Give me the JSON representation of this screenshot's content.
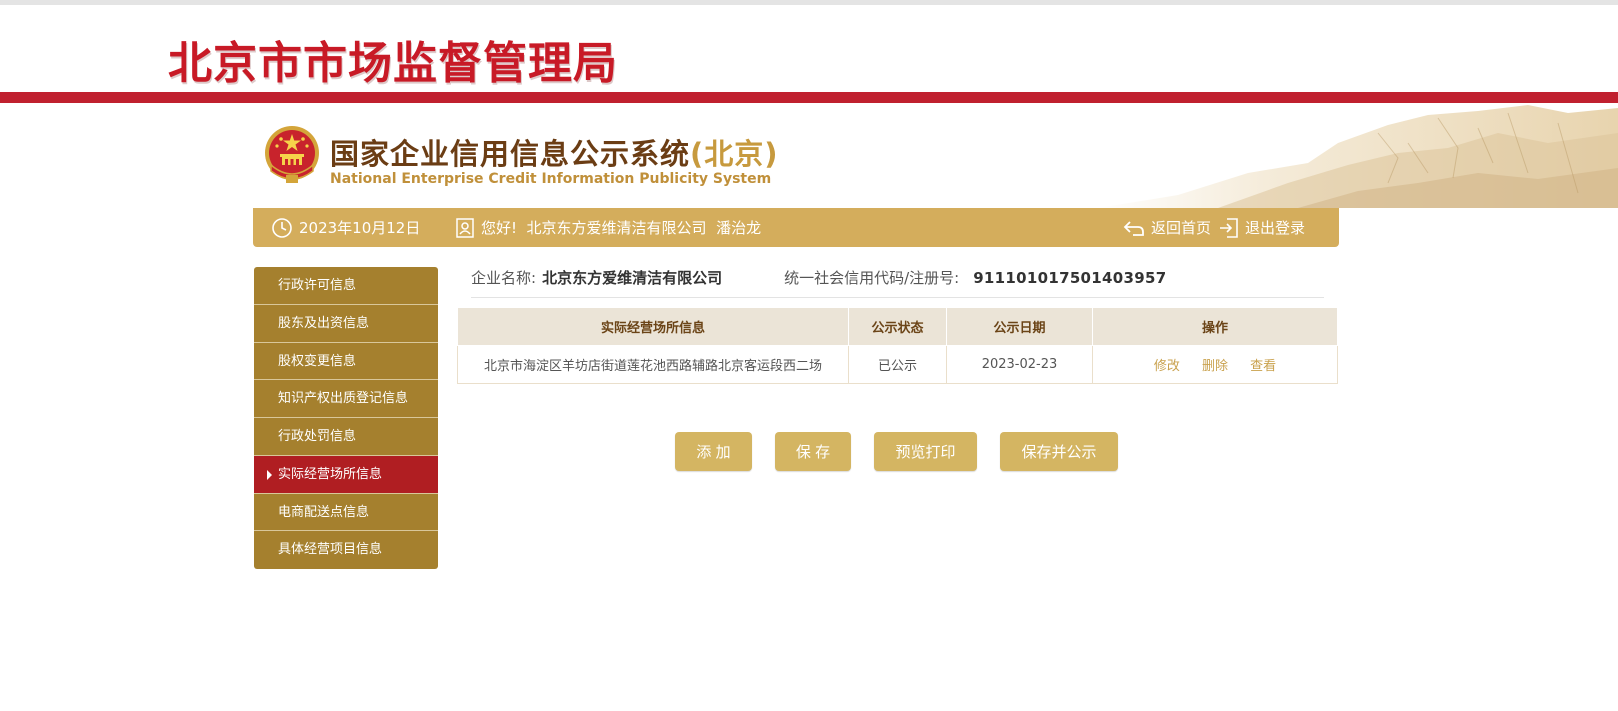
{
  "header": {
    "bureau_title": "北京市市场监督管理局"
  },
  "banner": {
    "system_title": "国家企业信用信息公示系统",
    "system_title_region": "(北京)",
    "system_subtitle": "National Enterprise Credit Information Publicity System"
  },
  "info_bar": {
    "date": "2023年10月12日",
    "greeting": "您好!  北京东方爱维清洁有限公司  潘治龙",
    "home_label": "返回首页",
    "logout_label": "退出登录"
  },
  "sidebar": {
    "items": [
      {
        "label": "行政许可信息",
        "active": false
      },
      {
        "label": "股东及出资信息",
        "active": false
      },
      {
        "label": "股权变更信息",
        "active": false
      },
      {
        "label": "知识产权出质登记信息",
        "active": false
      },
      {
        "label": "行政处罚信息",
        "active": false
      },
      {
        "label": "实际经营场所信息",
        "active": true
      },
      {
        "label": "电商配送点信息",
        "active": false
      },
      {
        "label": "具体经营项目信息",
        "active": false
      }
    ]
  },
  "company": {
    "name_label": "企业名称:",
    "name": "北京东方爱维清洁有限公司",
    "code_label": "统一社会信用代码/注册号:",
    "code": "911101017501403957"
  },
  "table": {
    "headers": [
      "实际经营场所信息",
      "公示状态",
      "公示日期",
      "操作"
    ],
    "rows": [
      {
        "address": "北京市海淀区羊坊店街道莲花池西路辅路北京客运段西二场",
        "status": "已公示",
        "date": "2023-02-23",
        "ops": [
          "修改",
          "删除",
          "查看"
        ]
      }
    ]
  },
  "actions": {
    "add": "添 加",
    "save": "保 存",
    "preview_print": "预览打印",
    "save_publish": "保存并公示"
  },
  "colors": {
    "brand_red": "#c81a26",
    "gold": "#d4ad5c",
    "sidebar_brown": "#a5802e",
    "active_red": "#b01e22"
  }
}
